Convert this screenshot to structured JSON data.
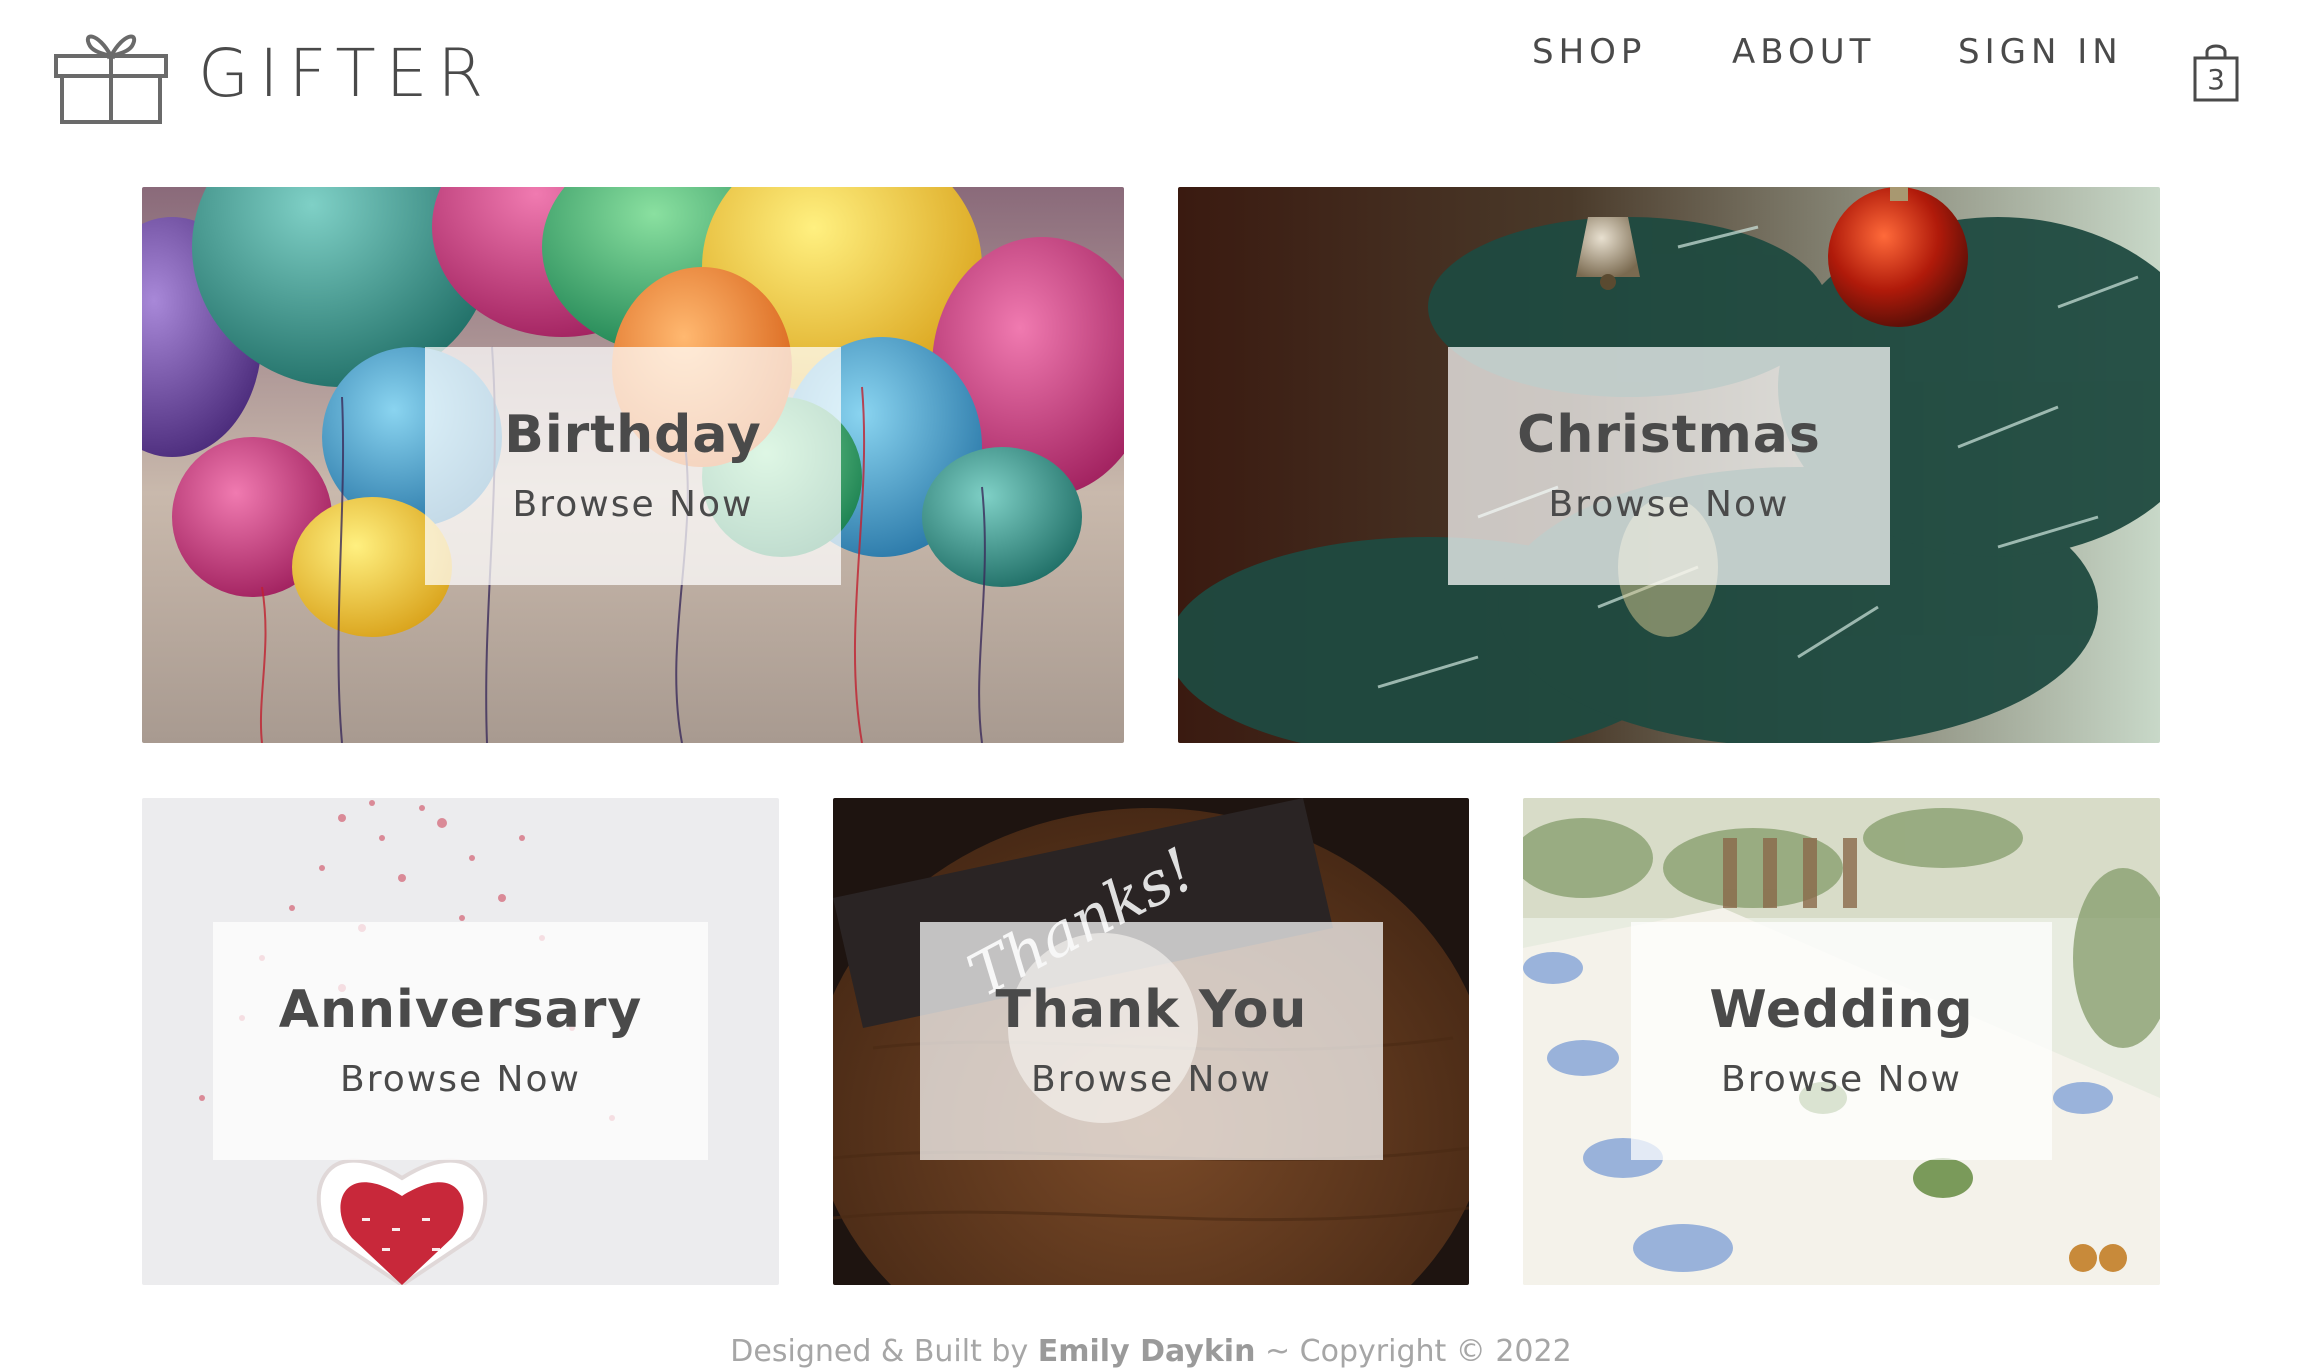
{
  "brand": {
    "name": "GIFTER",
    "icon": "gift-box-icon"
  },
  "nav": {
    "shop": "SHOP",
    "about": "ABOUT",
    "sign_in": "SIGN IN",
    "cart_icon": "shopping-bag-icon",
    "cart_count": "3"
  },
  "categories": [
    {
      "title": "Birthday",
      "cta": "Browse Now",
      "image": "balloons"
    },
    {
      "title": "Christmas",
      "cta": "Browse Now",
      "image": "christmas-tree-ornaments"
    },
    {
      "title": "Anniversary",
      "cta": "Browse Now",
      "image": "heart-bowl-sprinkles"
    },
    {
      "title": "Thank You",
      "cta": "Browse Now",
      "image": "thanks-card-coffee",
      "image_text": "Thanks!"
    },
    {
      "title": "Wedding",
      "cta": "Browse Now",
      "image": "wedding-table"
    }
  ],
  "footer": {
    "prefix": "Designed & Built by",
    "author": "Emily Daykin",
    "suffix": "~ Copyright © 2022"
  },
  "colors": {
    "text": "#4a4a4a",
    "footer": "#a6a6a6",
    "overlay": "rgba(255,255,255,0.72)"
  }
}
